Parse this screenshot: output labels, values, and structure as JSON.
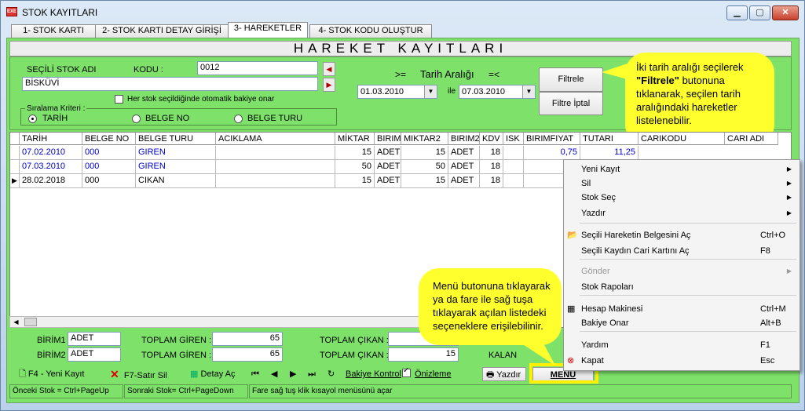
{
  "window": {
    "title": "STOK KAYITLARI",
    "icon": "app-logo-icon"
  },
  "tabs": [
    "1- STOK KARTI",
    "2- STOK KARTI DETAY GİRİŞİ",
    "3- HAREKETLER",
    "4- STOK KODU OLUŞTUR"
  ],
  "active_tab": "3- HAREKETLER",
  "header": "HAREKET KAYITLARI",
  "form": {
    "stok_adi_label": "SEÇİLİ STOK ADI",
    "kodu_label": "KODU :",
    "kodu_value": "0012",
    "stok_adi_value": "BİSKÜVİ",
    "auto_balance_label": "Her stok seçildiğinde otomatik bakiye onar",
    "sort_label": "Sıralama Kriteri :",
    "sort_options": [
      "TARİH",
      "BELGE NO",
      "BELGE TURU"
    ],
    "sort_selected": "TARİH"
  },
  "date_filter": {
    "ge": ">=",
    "title": "Tarih Aralığı",
    "le": "=<",
    "from": "01.03.2010",
    "ile": "ile",
    "to": "07.03.2010",
    "filter_btn": "Filtrele",
    "cancel_btn": "Filtre İptal"
  },
  "callout_top": {
    "line1": "İki tarih aralığı seçilerek",
    "bold": "\"Filtrele\"",
    "line2a": " butonuna",
    "line3": "tıklanarak, seçilen  tarih",
    "line4": "aralığındaki hareketler",
    "line5": "listelenebilir."
  },
  "grid": {
    "columns": [
      "TARİH",
      "BELGE NO",
      "BELGE TURU",
      "ACIKLAMA",
      "MİKTAR",
      "BIRIMI",
      "MIKTAR2",
      "BIRIM2",
      "KDV",
      "ISK",
      "BIRIMFIYAT",
      "TUTARI",
      "CARIKODU",
      "CARI ADI"
    ],
    "rows": [
      {
        "tarih": "07.02.2010",
        "belge_no": "000",
        "belge_turu": "GIREN",
        "aciklama": "",
        "miktar": "15",
        "birimi": "ADET",
        "miktar2": "15",
        "birim2": "ADET",
        "kdv": "18",
        "isk": "",
        "birimfiyat": "0,75",
        "tutari": "11,25"
      },
      {
        "tarih": "07.03.2010",
        "belge_no": "000",
        "belge_turu": "GIREN",
        "aciklama": "",
        "miktar": "50",
        "birimi": "ADET",
        "miktar2": "50",
        "birim2": "ADET",
        "kdv": "18",
        "isk": "",
        "birimfiyat": "",
        "tutari": ""
      },
      {
        "tarih": "28.02.2018",
        "belge_no": "000",
        "belge_turu": "CIKAN",
        "aciklama": "",
        "miktar": "15",
        "birimi": "ADET",
        "miktar2": "15",
        "birim2": "ADET",
        "kdv": "18",
        "isk": "",
        "birimfiyat": "",
        "tutari": ""
      }
    ]
  },
  "totals": {
    "birim1_label": "BİRİM1",
    "birim1": "ADET",
    "birim2_label": "BİRİM2",
    "birim2": "ADET",
    "toplam_giren_label": "TOPLAM GİREN :",
    "toplam_giren_1": "65",
    "toplam_giren_2": "65",
    "toplam_cikan_label": "TOPLAM ÇIKAN :",
    "toplam_cikan_2": "15",
    "kalan_label": "KALAN"
  },
  "toolbar": {
    "new": "F4 - Yeni Kayıt",
    "delete": "F7-Satır Sil",
    "detail": "Detay Aç",
    "refresh": "",
    "balance": "Bakiye Kontrol",
    "preview": "Önizleme",
    "print": "Yazdır",
    "menu": "MENU"
  },
  "status": [
    "Önceki Stok = Ctrl+PageUp",
    "Sonraki Stok= Ctrl+PageDown",
    "Fare sağ tuş klik kısayol menüsünü açar"
  ],
  "callout_bottom": [
    "Menü butonuna tıklayarak",
    "ya da fare ile sağ tuşa",
    "tıklayarak açılan listedeki",
    "seçeneklere erişilebilinir."
  ],
  "context_menu": [
    {
      "label": "Yeni Kayıt",
      "shortcut": "",
      "submenu": true
    },
    {
      "label": "Sil",
      "shortcut": "",
      "submenu": true
    },
    {
      "label": "Stok Seç",
      "shortcut": "",
      "submenu": true
    },
    {
      "label": "Yazdır",
      "shortcut": "",
      "submenu": true
    },
    {
      "label": "Seçili Hareketin Belgesini Aç",
      "shortcut": "Ctrl+O",
      "submenu": false
    },
    {
      "label": "Seçili Kaydın Cari Kartını Aç",
      "shortcut": "F8",
      "submenu": false
    },
    {
      "label": "Gönder",
      "shortcut": "",
      "submenu": true,
      "disabled": true
    },
    {
      "label": "Stok Rapoları",
      "shortcut": "",
      "submenu": false
    },
    {
      "label": "Hesap Makinesi",
      "shortcut": "Ctrl+M",
      "submenu": false
    },
    {
      "label": "Bakiye Onar",
      "shortcut": "Alt+B",
      "submenu": false
    },
    {
      "label": "Yardım",
      "shortcut": "F1",
      "submenu": false
    },
    {
      "label": "Kapat",
      "shortcut": "Esc",
      "submenu": false
    }
  ],
  "colors": {
    "panel_green": "#7ee26a",
    "callout_yellow": "#ffff2e",
    "highlight_yellow": "#ffef00"
  }
}
